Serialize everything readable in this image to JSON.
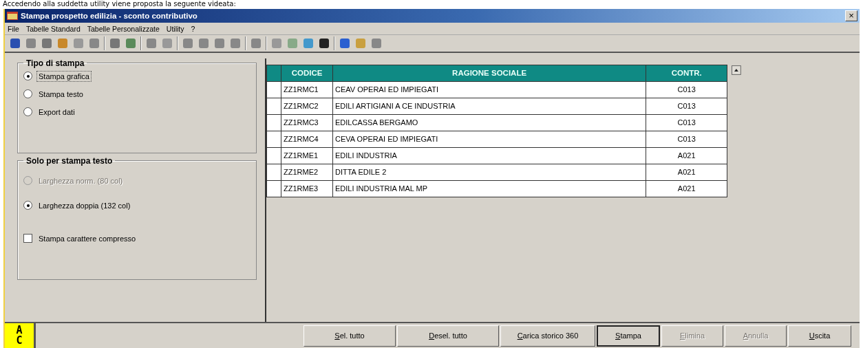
{
  "doc_caption": "Accedendo alla suddetta utility viene proposta la seguente videata:",
  "window": {
    "title": "Stampa prospetto edilizia - sconto contributivo",
    "close": "×"
  },
  "menu": [
    "File",
    "Tabelle Standard",
    "Tabelle Personalizzate",
    "Utility",
    "?"
  ],
  "groups": [
    {
      "title": "Tipo di stampa",
      "options": [
        {
          "kind": "radio",
          "label": "Stampa grafica",
          "selected": true,
          "disabled": false,
          "focused": true
        },
        {
          "kind": "radio",
          "label": "Stampa testo",
          "selected": false,
          "disabled": false,
          "focused": false
        },
        {
          "kind": "radio",
          "label": "Export dati",
          "selected": false,
          "disabled": false,
          "focused": false
        }
      ]
    },
    {
      "title": "Solo per stampa testo",
      "options": [
        {
          "kind": "radio",
          "label": "Larghezza norm. (80 col)",
          "selected": false,
          "disabled": true,
          "focused": false
        },
        {
          "kind": "radio",
          "label": "Larghezza doppia (132 col)",
          "selected": true,
          "disabled": false,
          "focused": false
        },
        {
          "kind": "checkbox",
          "label": "Stampa carattere compresso",
          "checked": false,
          "disabled": false,
          "focused": false
        }
      ]
    }
  ],
  "table": {
    "columns": [
      "CODICE",
      "RAGIONE SOCIALE",
      "CONTR."
    ],
    "rows": [
      [
        "ZZ1RMC1",
        "CEAV OPERAI ED IMPIEGATI",
        "C013"
      ],
      [
        "ZZ1RMC2",
        "EDILI ARTIGIANI A CE INDUSTRIA",
        "C013"
      ],
      [
        "ZZ1RMC3",
        "EDILCASSA BERGAMO",
        "C013"
      ],
      [
        "ZZ1RMC4",
        "CEVA OPERAI ED IMPIEGATI",
        "C013"
      ],
      [
        "ZZ1RME1",
        "EDILI INDUSTRIA",
        "A021"
      ],
      [
        "ZZ1RME2",
        "DITTA EDILE 2",
        "A021"
      ],
      [
        "ZZ1RME3",
        "EDILI INDUSTRIA MAL MP",
        "A021"
      ]
    ]
  },
  "logo": [
    "A",
    "C"
  ],
  "buttons": [
    {
      "label": "Sel. tutto",
      "disabled": false,
      "default": false
    },
    {
      "label": "Desel. tutto",
      "disabled": false,
      "default": false
    },
    {
      "label": "Carica storico 360",
      "disabled": false,
      "default": false
    },
    {
      "label": "Stampa",
      "disabled": false,
      "default": true
    },
    {
      "label": "Elimina",
      "disabled": true,
      "default": false
    },
    {
      "label": "Annulla",
      "disabled": true,
      "default": false
    },
    {
      "label": "Uscita",
      "disabled": false,
      "default": false
    }
  ]
}
